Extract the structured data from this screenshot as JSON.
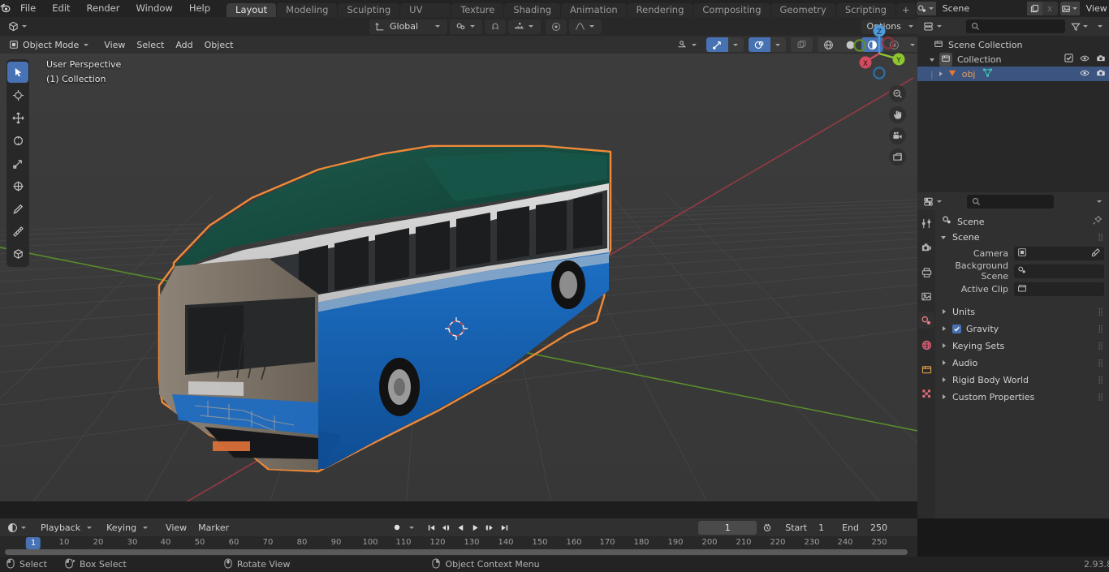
{
  "app": {
    "name": "Blender",
    "version": "2.93.8"
  },
  "topbar": {
    "logo_icon": "blender-logo-icon",
    "menus": [
      "File",
      "Edit",
      "Render",
      "Window",
      "Help"
    ],
    "workspace_tabs": [
      {
        "label": "Layout",
        "active": true
      },
      {
        "label": "Modeling",
        "active": false
      },
      {
        "label": "Sculpting",
        "active": false
      },
      {
        "label": "UV Editing",
        "active": false
      },
      {
        "label": "Texture Paint",
        "active": false
      },
      {
        "label": "Shading",
        "active": false
      },
      {
        "label": "Animation",
        "active": false
      },
      {
        "label": "Rendering",
        "active": false
      },
      {
        "label": "Compositing",
        "active": false
      },
      {
        "label": "Geometry Nodes",
        "active": false
      },
      {
        "label": "Scripting",
        "active": false
      }
    ],
    "add_workspace_label": "+",
    "scene": {
      "icon": "scene-icon",
      "name": "Scene",
      "new_label": "new-scene-copy-icon",
      "unlink_label": "x"
    },
    "view_layer": {
      "icon": "view-layer-icon",
      "name": "View Layer",
      "new_label": "new-view-layer-copy-icon",
      "unlink_label": "x"
    }
  },
  "viewport": {
    "header": {
      "editor_type_icon": "editor-type-3dview-icon",
      "mode": "Object Mode",
      "menus": [
        "View",
        "Select",
        "Add",
        "Object"
      ],
      "transform_orientation": "Global",
      "snap_icon": "magnet-icon",
      "proportional_icon": "proportional-edit-icon",
      "options_label": "Options",
      "visibility_icon": "object-visibility-icon",
      "gizmo_icon": "gizmo-icon",
      "overlays_icon": "overlays-icon",
      "xray_icon": "xray-icon",
      "shading_wireframe_icon": "shading-wireframe-icon",
      "shading_solid_icon": "shading-solid-icon",
      "shading_material_icon": "shading-material-icon",
      "shading_rendered_icon": "shading-rendered-icon"
    },
    "overlay_text": {
      "view_name": "User Perspective",
      "collection": "(1) Collection"
    },
    "toolbar": [
      {
        "name": "tweak-tool",
        "active": true
      },
      {
        "name": "cursor-tool",
        "active": false
      },
      {
        "name": "move-tool",
        "active": false
      },
      {
        "name": "rotate-tool",
        "active": false
      },
      {
        "name": "scale-tool",
        "active": false
      },
      {
        "name": "transform-tool",
        "active": false
      },
      {
        "name": "annotate-tool",
        "active": false
      },
      {
        "name": "measure-tool",
        "active": false
      },
      {
        "name": "add-cube-tool",
        "active": false
      }
    ],
    "gizmo_axes": {
      "x": "X",
      "y": "Y",
      "z": "Z"
    },
    "nav_buttons": [
      "zoom-navigate-icon",
      "pan-navigate-icon",
      "camera-view-icon",
      "toggle-ortho-persp-icon"
    ],
    "object_outline_color": "#f08a38",
    "scene_object": "city bus 3d model, selected with orange outline"
  },
  "outliner": {
    "display_mode_icon": "outliner-display-mode-icon",
    "search_placeholder": "",
    "filter_icon": "filter-icon",
    "rows": [
      {
        "label": "Scene Collection",
        "icon": "collection-icon",
        "indent": 0,
        "selected": false,
        "expander": "none",
        "checkbox": false,
        "eye": false,
        "camera": false
      },
      {
        "label": "Collection",
        "icon": "collection-icon",
        "indent": 1,
        "selected": false,
        "expander": "down",
        "checkbox": true,
        "eye": true,
        "camera": true
      },
      {
        "label": "obj",
        "icon": "mesh-object-icon",
        "indent": 2,
        "selected": true,
        "expander": "right",
        "checkbox": false,
        "eye": true,
        "camera": true
      }
    ]
  },
  "properties": {
    "editor_icon": "properties-editor-icon",
    "search_placeholder": "",
    "tabs": [
      {
        "name": "tool-tab",
        "icon": "tool-icon",
        "active": false
      },
      {
        "name": "render-tab",
        "icon": "render-camera-icon",
        "active": false
      },
      {
        "name": "output-tab",
        "icon": "printer-icon",
        "active": false
      },
      {
        "name": "view-layer-tab",
        "icon": "images-icon",
        "active": false
      },
      {
        "name": "scene-tab",
        "icon": "scene-cone-icon",
        "active": true
      },
      {
        "name": "world-tab",
        "icon": "world-globe-icon",
        "active": false
      },
      {
        "name": "object-tab",
        "icon": "object-box-icon",
        "active": false
      },
      {
        "name": "texture-tab",
        "icon": "texture-checker-icon",
        "active": false
      }
    ],
    "breadcrumb": {
      "icon": "scene-icon",
      "label": "Scene",
      "pin_icon": "pin-icon"
    },
    "panel_title": "Scene",
    "fields": [
      {
        "label": "Camera",
        "value": "",
        "icon": "camera-object-icon",
        "has_eyedropper": true
      },
      {
        "label": "Background Scene",
        "value": "",
        "icon": "scene-icon",
        "has_eyedropper": false
      },
      {
        "label": "Active Clip",
        "value": "",
        "icon": "movie-clip-icon",
        "has_eyedropper": false
      }
    ],
    "closed_panels": [
      {
        "label": "Units",
        "checkbox": false
      },
      {
        "label": "Gravity",
        "checkbox": true
      },
      {
        "label": "Keying Sets",
        "checkbox": false
      },
      {
        "label": "Audio",
        "checkbox": false
      },
      {
        "label": "Rigid Body World",
        "checkbox": false
      },
      {
        "label": "Custom Properties",
        "checkbox": false
      }
    ]
  },
  "timeline": {
    "editor_icon": "timeline-editor-icon",
    "menus": [
      "Playback",
      "Keying",
      "View",
      "Marker"
    ],
    "record_icon": "record-keyframe-icon",
    "transport": [
      "jump-to-start-icon",
      "jump-to-prev-keyframe-icon",
      "play-reverse-icon",
      "play-icon",
      "jump-to-next-keyframe-icon",
      "jump-to-end-icon"
    ],
    "current_frame": "1",
    "auto_key_icon": "auto-keying-icon",
    "start_label": "Start",
    "start_value": "1",
    "end_label": "End",
    "end_value": "250",
    "playhead_label": "1",
    "ticks": [
      "10",
      "20",
      "30",
      "40",
      "50",
      "60",
      "70",
      "80",
      "90",
      "100",
      "110",
      "120",
      "130",
      "140",
      "150",
      "160",
      "170",
      "180",
      "190",
      "200",
      "210",
      "220",
      "230",
      "240",
      "250"
    ]
  },
  "statusbar": {
    "items": [
      {
        "icon": "mouse-left-icon",
        "label": "Select"
      },
      {
        "icon": "mouse-left-drag-icon",
        "label": "Box Select"
      },
      {
        "icon": "mouse-middle-icon",
        "label": "Rotate View"
      },
      {
        "icon": "mouse-right-icon",
        "label": "Object Context Menu"
      }
    ],
    "version": "2.93.8"
  }
}
